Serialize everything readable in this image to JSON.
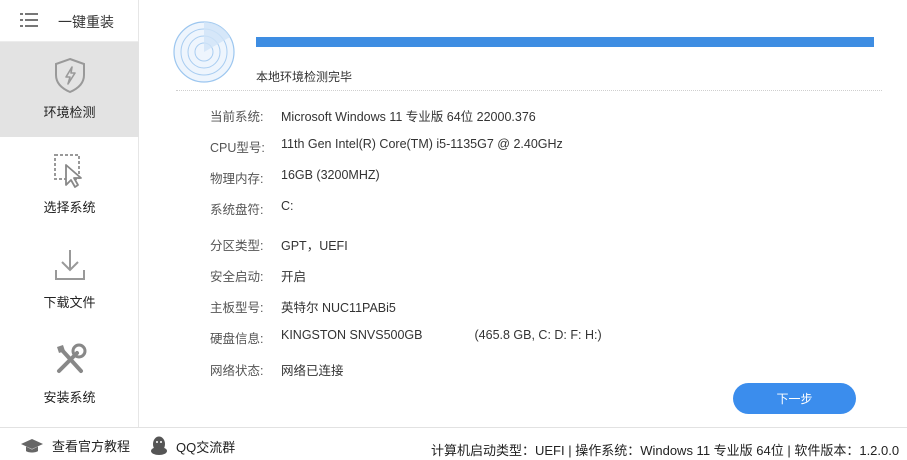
{
  "sidebar": {
    "title": "一键重装",
    "items": [
      {
        "label": "环境检测",
        "icon": "shield-icon",
        "active": true
      },
      {
        "label": "选择系统",
        "icon": "cursor-icon",
        "active": false
      },
      {
        "label": "下载文件",
        "icon": "download-icon",
        "active": false
      },
      {
        "label": "安装系统",
        "icon": "tools-icon",
        "active": false
      }
    ]
  },
  "progress": {
    "value": 1.0,
    "status": "本地环境检测完毕"
  },
  "info": [
    {
      "label": "当前系统:",
      "value": "Microsoft Windows 11 专业版 64位 22000.376"
    },
    {
      "label": "CPU型号:",
      "value": "11th Gen Intel(R) Core(TM) i5-1135G7 @ 2.40GHz"
    },
    {
      "label": "物理内存:",
      "value": "16GB (3200MHZ)"
    },
    {
      "label": "系统盘符:",
      "value": "C:"
    },
    {
      "label": "分区类型:",
      "value": "GPT，UEFI"
    },
    {
      "label": "安全启动:",
      "value": "开启"
    },
    {
      "label": "主板型号:",
      "value": "英特尔 NUC11PABi5"
    },
    {
      "label": "硬盘信息:",
      "value": "KINGSTON SNVS500GB",
      "extra": "(465.8 GB, C: D: F: H:)"
    },
    {
      "label": "网络状态:",
      "value": "网络已连接"
    }
  ],
  "next_button": "下一步",
  "footer": {
    "tutorial": "查看官方教程",
    "qq_group": "QQ交流群",
    "status": "计算机启动类型：UEFI | 操作系统：Windows 11 专业版 64位 | 软件版本：1.2.0.0"
  },
  "colors": {
    "accent": "#3b8ded",
    "active_bg": "#e3e3e3"
  }
}
